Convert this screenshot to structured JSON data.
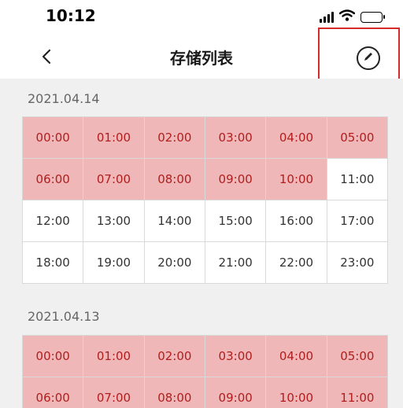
{
  "status_bar": {
    "time": "10:12",
    "icons": [
      "signal-icon",
      "wifi-icon",
      "battery-icon"
    ]
  },
  "nav": {
    "back_icon": "chevron-left-icon",
    "title": "存储列表",
    "edit_icon": "pencil-icon"
  },
  "colors": {
    "recorded_bg": "#f0b7b8",
    "recorded_text": "#b01e1e",
    "highlight_box": "#d62b2b",
    "page_bg": "#f0f0f0"
  },
  "days": [
    {
      "date": "2021.04.14",
      "slots": [
        {
          "time": "00:00",
          "recorded": true
        },
        {
          "time": "01:00",
          "recorded": true
        },
        {
          "time": "02:00",
          "recorded": true
        },
        {
          "time": "03:00",
          "recorded": true
        },
        {
          "time": "04:00",
          "recorded": true
        },
        {
          "time": "05:00",
          "recorded": true
        },
        {
          "time": "06:00",
          "recorded": true
        },
        {
          "time": "07:00",
          "recorded": true
        },
        {
          "time": "08:00",
          "recorded": true
        },
        {
          "time": "09:00",
          "recorded": true
        },
        {
          "time": "10:00",
          "recorded": true
        },
        {
          "time": "11:00",
          "recorded": false
        },
        {
          "time": "12:00",
          "recorded": false
        },
        {
          "time": "13:00",
          "recorded": false
        },
        {
          "time": "14:00",
          "recorded": false
        },
        {
          "time": "15:00",
          "recorded": false
        },
        {
          "time": "16:00",
          "recorded": false
        },
        {
          "time": "17:00",
          "recorded": false
        },
        {
          "time": "18:00",
          "recorded": false
        },
        {
          "time": "19:00",
          "recorded": false
        },
        {
          "time": "20:00",
          "recorded": false
        },
        {
          "time": "21:00",
          "recorded": false
        },
        {
          "time": "22:00",
          "recorded": false
        },
        {
          "time": "23:00",
          "recorded": false
        }
      ]
    },
    {
      "date": "2021.04.13",
      "slots": [
        {
          "time": "00:00",
          "recorded": true
        },
        {
          "time": "01:00",
          "recorded": true
        },
        {
          "time": "02:00",
          "recorded": true
        },
        {
          "time": "03:00",
          "recorded": true
        },
        {
          "time": "04:00",
          "recorded": true
        },
        {
          "time": "05:00",
          "recorded": true
        },
        {
          "time": "06:00",
          "recorded": true
        },
        {
          "time": "07:00",
          "recorded": true
        },
        {
          "time": "08:00",
          "recorded": true
        },
        {
          "time": "09:00",
          "recorded": true
        },
        {
          "time": "10:00",
          "recorded": true
        },
        {
          "time": "11:00",
          "recorded": true
        }
      ]
    }
  ]
}
